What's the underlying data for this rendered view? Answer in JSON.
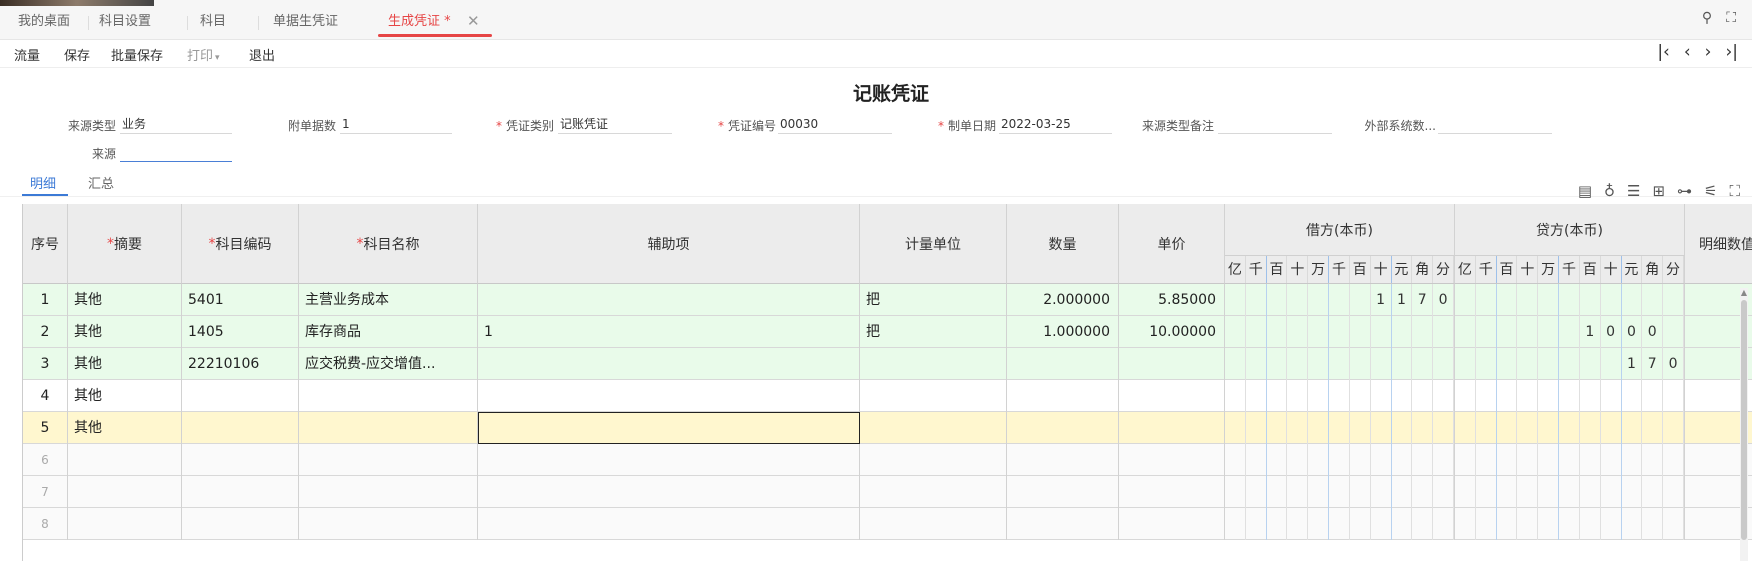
{
  "tabs": [
    {
      "label": "我的桌面"
    },
    {
      "label": "科目设置"
    },
    {
      "label": "科目"
    },
    {
      "label": "单据生凭证"
    },
    {
      "label": "生成凭证 *"
    }
  ],
  "toolbar": {
    "flow": "流量",
    "save": "保存",
    "batch_save": "批量保存",
    "print": "打印",
    "exit": "退出"
  },
  "title": "记账凭证",
  "form": {
    "source_type": {
      "label": "来源类型",
      "value": "业务"
    },
    "attachments": {
      "label": "附单据数",
      "value": "1"
    },
    "voucher_type": {
      "label": "凭证类别",
      "value": "记账凭证"
    },
    "voucher_no": {
      "label": "凭证编号",
      "value": "00030"
    },
    "date": {
      "label": "制单日期",
      "value": "2022-03-25"
    },
    "source_remark": {
      "label": "来源类型备注",
      "value": ""
    },
    "external": {
      "label": "外部系统数...",
      "value": ""
    },
    "source": {
      "label": "来源",
      "value": ""
    }
  },
  "detail_tabs": {
    "detail": "明细",
    "summary": "汇总"
  },
  "table": {
    "headers": {
      "seq": "序号",
      "summary": "摘要",
      "code": "科目编码",
      "name": "科目名称",
      "aux": "辅助项",
      "unit": "计量单位",
      "qty": "数量",
      "price": "单价",
      "debit": "借方(本币)",
      "credit": "贷方(本币)",
      "detail_num": "明细数值"
    },
    "digit_units": [
      "亿",
      "千",
      "百",
      "十",
      "万",
      "千",
      "百",
      "十",
      "元",
      "角",
      "分"
    ],
    "rows": [
      {
        "seq": "1",
        "summary": "其他",
        "code": "5401",
        "name": "主营业务成本",
        "aux": "",
        "unit": "把",
        "qty": "2.000000",
        "price": "5.85000",
        "debit": [
          "",
          "",
          "",
          "",
          "",
          "",
          "",
          "1",
          "1",
          "7",
          "0"
        ],
        "credit": [
          "",
          "",
          "",
          "",
          "",
          "",
          "",
          "",
          "",
          "",
          ""
        ]
      },
      {
        "seq": "2",
        "summary": "其他",
        "code": "1405",
        "name": "库存商品",
        "aux": "1",
        "unit": "把",
        "qty": "1.000000",
        "price": "10.00000",
        "debit": [
          "",
          "",
          "",
          "",
          "",
          "",
          "",
          "",
          "",
          "",
          ""
        ],
        "credit": [
          "",
          "",
          "",
          "",
          "",
          "",
          "1",
          "0",
          "0",
          "0",
          ""
        ]
      },
      {
        "seq": "3",
        "summary": "其他",
        "code": "22210106",
        "name": "应交税费-应交增值...",
        "aux": "",
        "unit": "",
        "qty": "",
        "price": "",
        "debit": [
          "",
          "",
          "",
          "",
          "",
          "",
          "",
          "",
          "",
          "",
          ""
        ],
        "credit": [
          "",
          "",
          "",
          "",
          "",
          "",
          "",
          "",
          "1",
          "7",
          "0"
        ]
      },
      {
        "seq": "4",
        "summary": "其他",
        "code": "",
        "name": "",
        "aux": "",
        "unit": "",
        "qty": "",
        "price": "",
        "debit": [
          "",
          "",
          "",
          "",
          "",
          "",
          "",
          "",
          "",
          "",
          ""
        ],
        "credit": [
          "",
          "",
          "",
          "",
          "",
          "",
          "",
          "",
          "",
          "",
          ""
        ]
      },
      {
        "seq": "5",
        "summary": "其他",
        "code": "",
        "name": "",
        "aux": "",
        "unit": "",
        "qty": "",
        "price": "",
        "debit": [
          "",
          "",
          "",
          "",
          "",
          "",
          "",
          "",
          "",
          "",
          ""
        ],
        "credit": [
          "",
          "",
          "",
          "",
          "",
          "",
          "",
          "",
          "",
          "",
          ""
        ]
      },
      {
        "seq": "6",
        "summary": "",
        "code": "",
        "name": "",
        "aux": "",
        "unit": "",
        "qty": "",
        "price": "",
        "debit": [
          "",
          "",
          "",
          "",
          "",
          "",
          "",
          "",
          "",
          "",
          ""
        ],
        "credit": [
          "",
          "",
          "",
          "",
          "",
          "",
          "",
          "",
          "",
          "",
          ""
        ]
      },
      {
        "seq": "7",
        "summary": "",
        "code": "",
        "name": "",
        "aux": "",
        "unit": "",
        "qty": "",
        "price": "",
        "debit": [
          "",
          "",
          "",
          "",
          "",
          "",
          "",
          "",
          "",
          "",
          ""
        ],
        "credit": [
          "",
          "",
          "",
          "",
          "",
          "",
          "",
          "",
          "",
          "",
          ""
        ]
      },
      {
        "seq": "8",
        "summary": "",
        "code": "",
        "name": "",
        "aux": "",
        "unit": "",
        "qty": "",
        "price": "",
        "debit": [
          "",
          "",
          "",
          "",
          "",
          "",
          "",
          "",
          "",
          "",
          ""
        ],
        "credit": [
          "",
          "",
          "",
          "",
          "",
          "",
          "",
          "",
          "",
          "",
          ""
        ]
      }
    ]
  },
  "colors": {
    "accent": "#e64545",
    "link": "#3c7ad6",
    "row_filled": "#e9fbea",
    "row_active": "#fff7cf"
  }
}
